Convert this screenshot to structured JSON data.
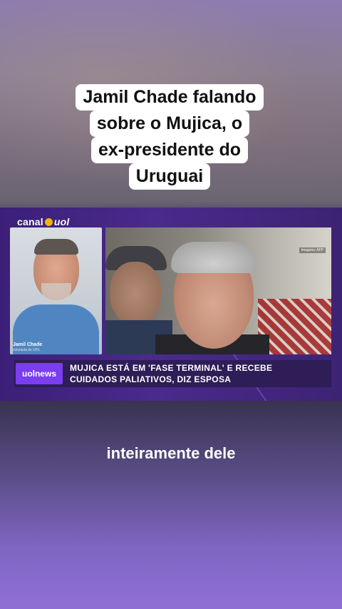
{
  "caption": {
    "lines": [
      "Jamil Chade falando",
      "sobre o Mujica, o",
      "ex-presidente do",
      "Uruguai"
    ]
  },
  "video": {
    "logo": {
      "text": "canal",
      "brand": "uol"
    },
    "camera": {
      "name": "Jamil Chade",
      "role": "colunista do UOL"
    },
    "photo_credit": "Imagens: AFP",
    "lower_third": {
      "badge": "uolnews",
      "headline_line1": "MUJICA ESTÁ EM 'FASE TERMINAL' E RECEBE",
      "headline_line2": "CUIDADOS PALIATIVOS, DIZ ESPOSA"
    }
  },
  "subtitle": "inteiramente dele",
  "colors": {
    "badge": "#7a3df0",
    "lower_third_bg": "#2e1d57",
    "video_bg": "#4a2a8c"
  }
}
